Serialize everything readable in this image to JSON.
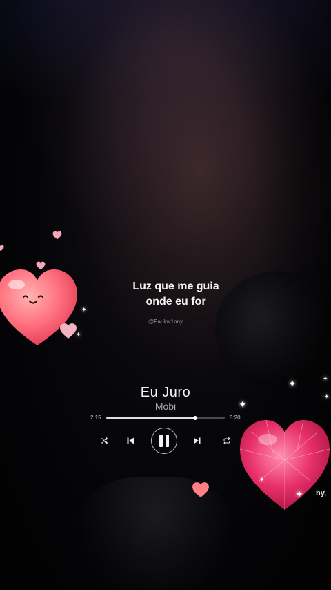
{
  "lyrics": {
    "line1": "Luz que me guia",
    "line2": "onde eu for",
    "watermark": "@Paulov1nny"
  },
  "player": {
    "title": "Eu Juro",
    "artist": "Mobi",
    "current_time": "2:15",
    "total_time": "5:20",
    "progress": 0.75,
    "controls": {
      "shuffle_icon": "shuffle-icon",
      "previous_icon": "skip-previous-icon",
      "pause_icon": "pause-icon",
      "next_icon": "skip-next-icon",
      "repeat_icon": "repeat-icon"
    }
  },
  "stickers": {
    "partial_text": "ny,",
    "colors": {
      "pink_heart": "#ff6f7d",
      "gem_heart": "#e8306a"
    }
  }
}
